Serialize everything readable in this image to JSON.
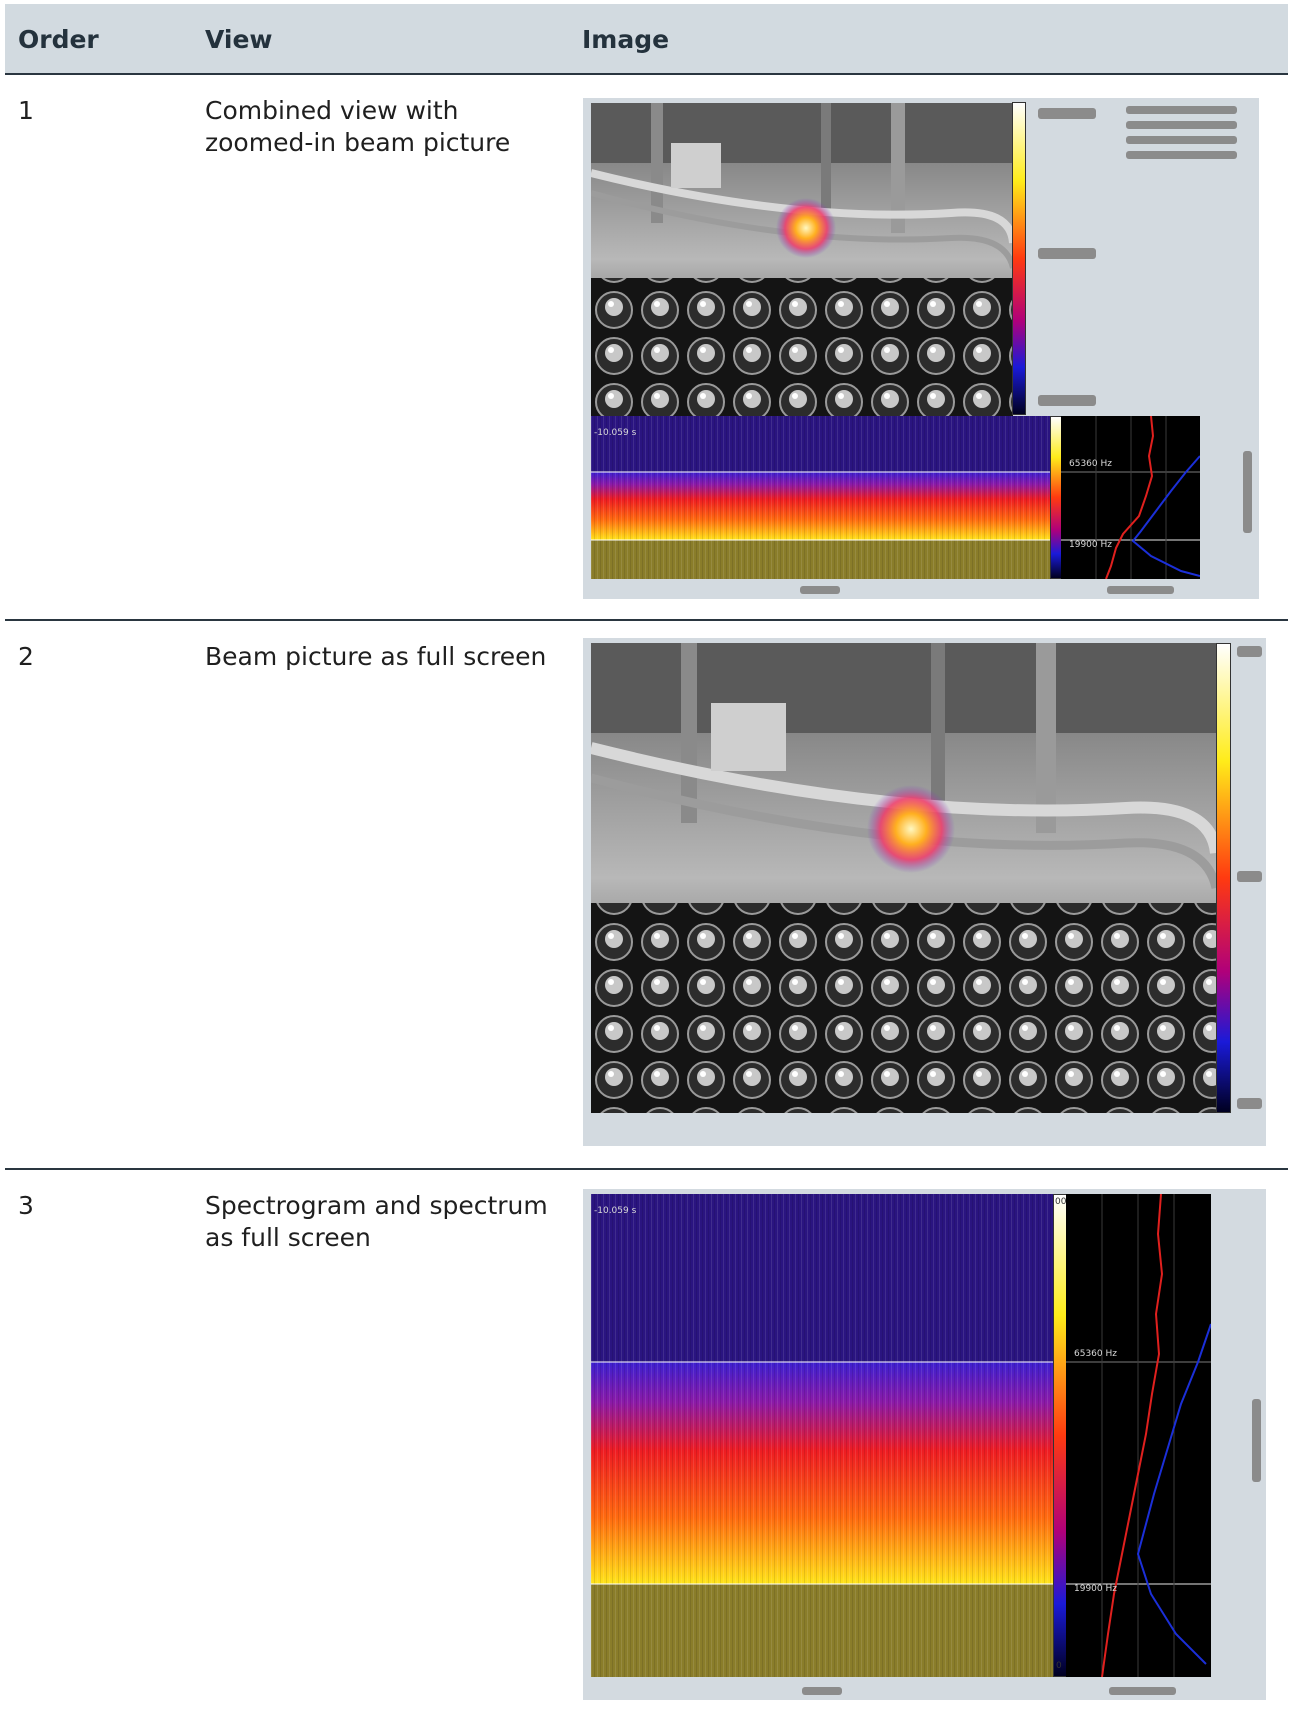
{
  "header": {
    "order": "Order",
    "view": "View",
    "image": "Image"
  },
  "rows": [
    {
      "order": "1",
      "view": "Combined view with zoomed-in beam picture"
    },
    {
      "order": "2",
      "view": "Beam picture as full screen"
    },
    {
      "order": "3",
      "view": "Spectrogram and spectrum as full screen"
    }
  ],
  "overlay": {
    "time": "-10.059 s",
    "freq_high": "65360 Hz",
    "freq_low": "19900 Hz",
    "scale_top": "00",
    "scale_bottom": "0"
  },
  "colors": {
    "header_bg": "#d2dae0",
    "rule": "#2a3640",
    "panel": "#d3dae0",
    "placeholder": "#8b8b8b",
    "spectrum_high": "#e0201e",
    "spectrum_low": "#1b2fd8"
  }
}
